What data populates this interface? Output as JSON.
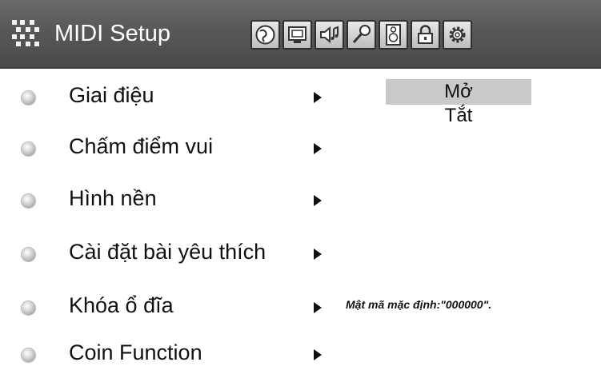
{
  "header": {
    "title": "MIDI Setup",
    "menu_icon": "midi-grid-icon",
    "toolbar_icons": [
      "globe-icon",
      "monitor-icon",
      "speaker-music-icon",
      "microphone-icon",
      "audio-speaker-icon",
      "lock-icon",
      "gear-icon"
    ]
  },
  "menu": {
    "items": [
      {
        "label": "Giai điệu",
        "has_submenu": true
      },
      {
        "label": "Chấm điểm vui",
        "has_submenu": true
      },
      {
        "label": "Hình nền",
        "has_submenu": true
      },
      {
        "label": "Cài đặt bài yêu thích",
        "has_submenu": true
      },
      {
        "label": "Khóa ổ đĩa",
        "has_submenu": true
      },
      {
        "label": "Coin Function",
        "has_submenu": true
      }
    ]
  },
  "submenu": {
    "options": [
      "Mở",
      "Tắt"
    ],
    "selected": "Mở"
  },
  "notes": {
    "disk_lock_password": "Mật mã mặc định:\"000000\"."
  },
  "colors": {
    "header_bg": "#585858",
    "selected_bg": "#c9c9c9"
  }
}
